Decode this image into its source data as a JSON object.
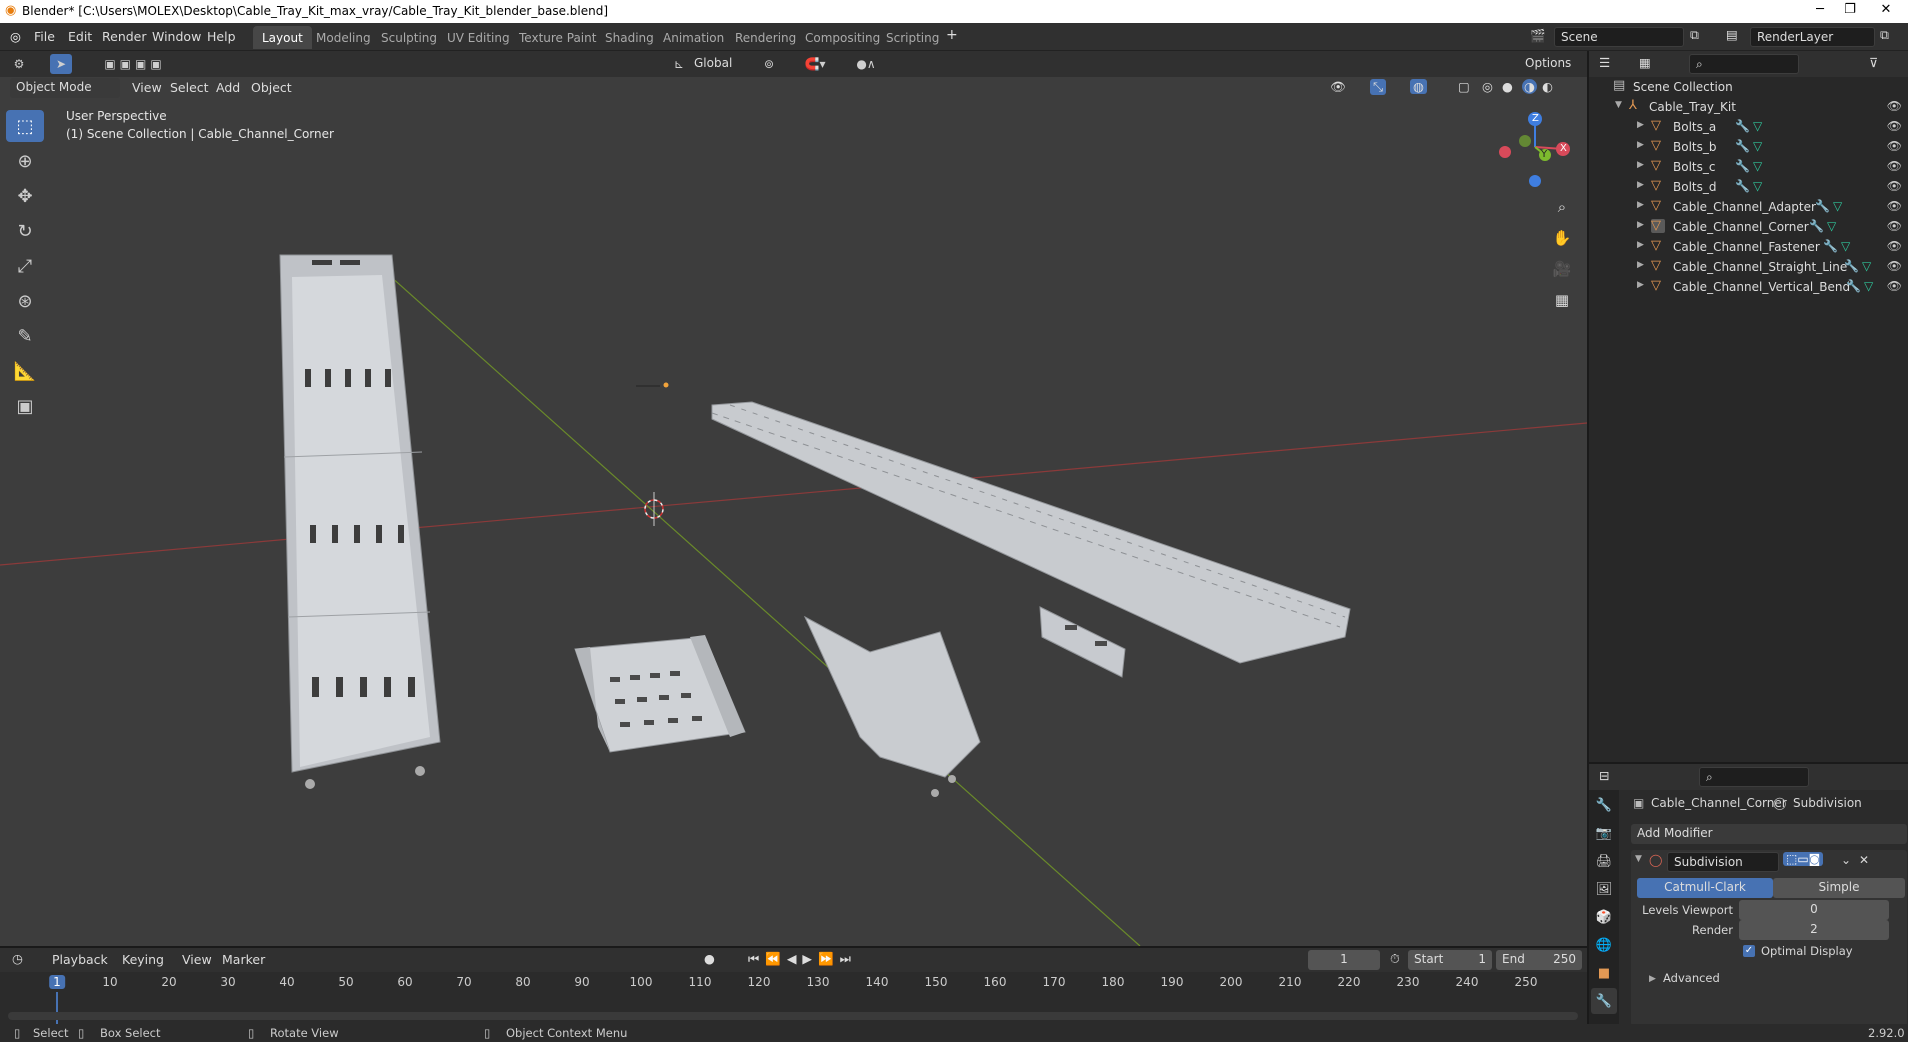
{
  "window": {
    "title": "Blender* [C:\\Users\\MOLEX\\Desktop\\Cable_Tray_Kit_max_vray/Cable_Tray_Kit_blender_base.blend]",
    "min": "─",
    "max": "❐",
    "close": "✕"
  },
  "menu": [
    "File",
    "Edit",
    "Render",
    "Window",
    "Help"
  ],
  "workspaces": [
    "Layout",
    "Modeling",
    "Sculpting",
    "UV Editing",
    "Texture Paint",
    "Shading",
    "Animation",
    "Rendering",
    "Compositing",
    "Scripting"
  ],
  "active_workspace": "Layout",
  "scene": {
    "name": "Scene",
    "view_layer": "RenderLayer"
  },
  "viewport_header": {
    "orientation": "Global",
    "options": "Options",
    "mode": "Object Mode",
    "menus": [
      "View",
      "Select",
      "Add",
      "Object"
    ]
  },
  "viewport": {
    "perspective": "User Perspective",
    "collection_info": "(1) Scene Collection | Cable_Channel_Corner",
    "axes": {
      "x": "X",
      "y": "Y",
      "z": "Z"
    }
  },
  "outliner": {
    "root": "Scene Collection",
    "collection": "Cable_Tray_Kit",
    "items": [
      "Bolts_a",
      "Bolts_b",
      "Bolts_c",
      "Bolts_d",
      "Cable_Channel_Adapter",
      "Cable_Channel_Corner",
      "Cable_Channel_Fastener",
      "Cable_Channel_Straight_Line",
      "Cable_Channel_Vertical_Bend"
    ]
  },
  "properties": {
    "object": "Cable_Channel_Corner",
    "modifier_tab": "Subdivision",
    "add_modifier": "Add Modifier",
    "modifier_name": "Subdivision",
    "type_a": "Catmull-Clark",
    "type_b": "Simple",
    "levels_viewport_label": "Levels Viewport",
    "levels_viewport": "0",
    "render_label": "Render",
    "render": "2",
    "optimal_display": "Optimal Display",
    "advanced": "Advanced"
  },
  "timeline": {
    "menus": [
      "Playback",
      "Keying",
      "View",
      "Marker"
    ],
    "current_frame": "1",
    "start_label": "Start",
    "start": "1",
    "end_label": "End",
    "end": "250",
    "ticks": [
      "1",
      "10",
      "20",
      "30",
      "40",
      "50",
      "60",
      "70",
      "80",
      "90",
      "100",
      "110",
      "120",
      "130",
      "140",
      "150",
      "160",
      "170",
      "180",
      "190",
      "200",
      "210",
      "220",
      "230",
      "240",
      "250"
    ]
  },
  "statusbar": {
    "select": "Select",
    "box_select": "Box Select",
    "rotate": "Rotate View",
    "context": "Object Context Menu",
    "version": "2.92.0"
  },
  "colors": {
    "accent": "#4772b3",
    "object": "#e39954",
    "mesh": "#2fc49a",
    "grid_x": "#a03b3b",
    "grid_y": "#6b8f2a"
  }
}
